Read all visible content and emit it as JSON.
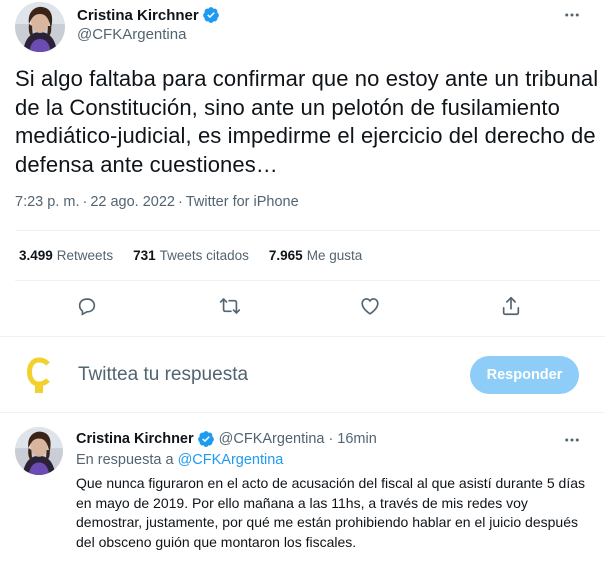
{
  "tweet": {
    "author_name": "Cristina Kirchner",
    "author_handle": "@CFKArgentina",
    "text": "Si algo faltaba para confirmar que no estoy ante un tribunal de la Constitución, sino ante un pelotón de fusilamiento mediático-judicial, es impedirme el ejercicio del derecho de defensa ante cuestiones…",
    "time": "7:23 p. m.",
    "date": "22 ago. 2022",
    "source": "Twitter for iPhone",
    "separator": "·",
    "stats": [
      {
        "count": "3.499",
        "label": "Retweets"
      },
      {
        "count": "731",
        "label": "Tweets citados"
      },
      {
        "count": "7.965",
        "label": "Me gusta"
      }
    ],
    "more_icon": "more-horizontal-icon",
    "verified_icon": "verified-badge-icon"
  },
  "actions": {
    "reply_icon": "reply-icon",
    "retweet_icon": "retweet-icon",
    "like_icon": "like-icon",
    "share_icon": "share-icon"
  },
  "compose": {
    "placeholder": "Twittea tu respuesta",
    "button_label": "Responder",
    "button_color": "#8ecdf7"
  },
  "reply": {
    "author_name": "Cristina Kirchner",
    "author_handle": "@CFKArgentina",
    "separator": "·",
    "time": "16min",
    "in_reply_prefix": "En respuesta a",
    "in_reply_handle": "@CFKArgentina",
    "text": "Que nunca figuraron en el acto de acusación del fiscal al que asistí durante 5 días en mayo de 2019. Por ello mañana a las 11hs, a través de mis redes voy demostrar, justamente, por qué me están prohibiendo hablar en el juicio después del obsceno guión que montaron los fiscales."
  },
  "colors": {
    "accent": "#1d9bf0",
    "secondary_text": "#536471",
    "logo_yellow": "#f2d12e"
  }
}
